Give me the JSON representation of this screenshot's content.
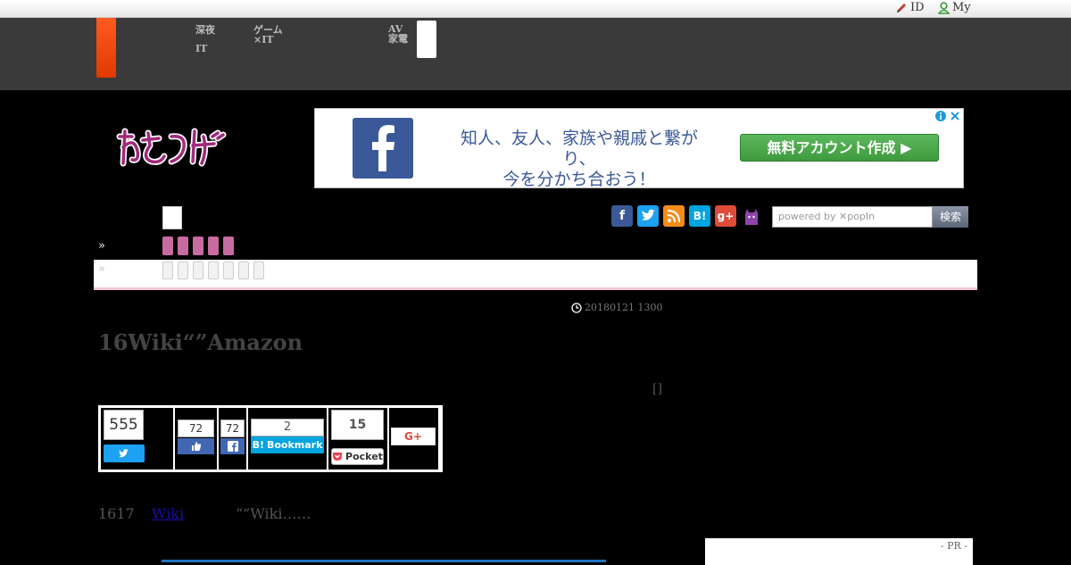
{
  "topbar": {
    "id_label": "ID",
    "my_label": "My"
  },
  "header": {
    "nav": [
      {
        "line1": "深夜",
        "line2": "IT"
      },
      {
        "line1": "ゲーム",
        "line2": "×IT"
      },
      {
        "line1": "AV",
        "line2": "家電"
      }
    ]
  },
  "ad": {
    "text_line1": "知人、友人、家族や親戚と繋がり、",
    "text_line2": "今を分かち合おう！",
    "button": "無料アカウント作成 ▶"
  },
  "search": {
    "placeholder": "powered by ✕popIn",
    "button": "検索"
  },
  "breadcrumb": {
    "arrow1": "»",
    "arrow2": "»"
  },
  "article": {
    "datetime": "20180121 1300",
    "title": "16Wiki“”Amazon",
    "author_mark": "[]",
    "body_prefix": "1617",
    "body_link": "Wiki",
    "body_suffix": "“”Wiki……"
  },
  "share": {
    "twitter_count": "555",
    "like_count": "72",
    "fb_count": "72",
    "hatena_count": "2",
    "hatena_label": "Bookmark",
    "pocket_count": "15",
    "pocket_label": "Pocket",
    "gplus_label": "G+"
  },
  "pr": {
    "label": "- PR -"
  },
  "colors": {
    "header_bg": "#3a3a3a",
    "accent_orange": "#ff5a1f",
    "pink": "#c86ba0",
    "facebook": "#3b5998",
    "twitter": "#1da1f2",
    "hatena": "#00a4de",
    "pocket": "#ee4056"
  }
}
